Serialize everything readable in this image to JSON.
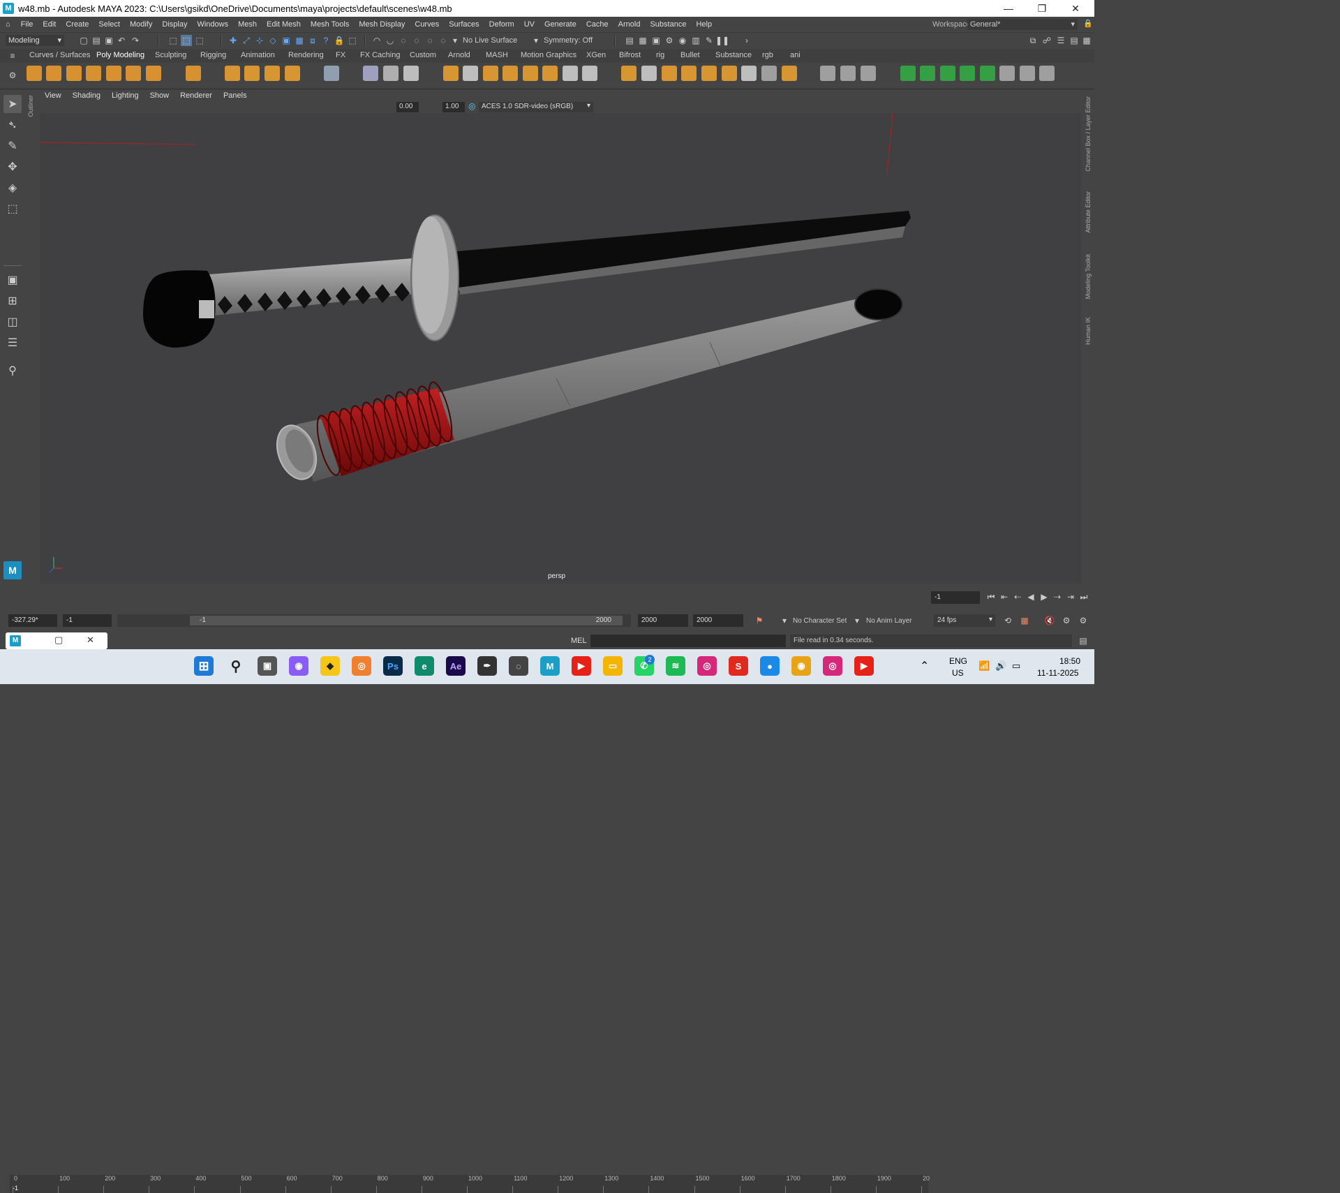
{
  "window": {
    "title": "w48.mb - Autodesk MAYA 2023: C:\\Users\\gsikd\\OneDrive\\Documents\\maya\\projects\\default\\scenes\\w48.mb",
    "app_icon": "M",
    "controls": {
      "minimize": "—",
      "restore": "❐",
      "close": "✕"
    }
  },
  "menubar": {
    "items": [
      "File",
      "Edit",
      "Create",
      "Select",
      "Modify",
      "Display",
      "Windows",
      "Mesh",
      "Edit Mesh",
      "Mesh Tools",
      "Mesh Display",
      "Curves",
      "Surfaces",
      "Deform",
      "UV",
      "Generate",
      "Cache",
      "Arnold",
      "Substance",
      "Help"
    ],
    "workspace_label": "Workspace:",
    "workspace_value": "General*"
  },
  "statusline": {
    "mode": "Modeling",
    "live_surface": "No Live Surface",
    "symmetry": "Symmetry: Off"
  },
  "shelf_tabs": [
    "Curves / Surfaces",
    "Poly Modeling",
    "Sculpting",
    "Rigging",
    "Animation",
    "Rendering",
    "FX",
    "FX Caching",
    "Custom",
    "Arnold",
    "MASH",
    "Motion Graphics",
    "XGen",
    "Bifrost",
    "rig",
    "Bullet",
    "Substance",
    "rgb",
    "ani"
  ],
  "panel_menu": [
    "View",
    "Shading",
    "Lighting",
    "Show",
    "Renderer",
    "Panels"
  ],
  "panel_toolbar": {
    "exposure": "0.00",
    "gamma": "1.00",
    "color_space": "ACES 1.0 SDR-video (sRGB)"
  },
  "side_tabs": {
    "left": "Outliner",
    "right": [
      "Channel Box / Layer Editor",
      "Attribute Editor",
      "Modeling Toolkit",
      "Human IK"
    ]
  },
  "viewport": {
    "camera_label": "persp"
  },
  "timeline": {
    "ticks": [
      "0",
      "100",
      "200",
      "300",
      "400",
      "500",
      "600",
      "700",
      "800",
      "900",
      "1000",
      "1100",
      "1200",
      "1300",
      "1400",
      "1500",
      "1600",
      "1700",
      "1800",
      "1900",
      "20"
    ],
    "current_frame": "-1",
    "current_frame_field": "-1"
  },
  "range": {
    "coord": "-327.29*",
    "start": "-1",
    "slider_start": "-1",
    "slider_end": "2000",
    "end": "2000",
    "end2": "2000",
    "character_set": "No Character Set",
    "anim_layer": "No Anim Layer",
    "fps": "24 fps"
  },
  "command": {
    "lang": "MEL",
    "result": "File read in  0.34 seconds."
  },
  "taskbar": {
    "lang_top": "ENG",
    "lang_bottom": "US",
    "time": "18:50",
    "date": "11-11-2025",
    "whatsapp_badge": "2",
    "icons": [
      "windows-start-icon",
      "search-icon",
      "task-view-icon",
      "copilot-icon",
      "sticky-icon",
      "blender-icon",
      "photoshop-icon",
      "edge-icon",
      "after-effects-icon",
      "inkscape-icon",
      "obs-icon",
      "maya-icon",
      "youtube-icon",
      "file-explorer-icon",
      "whatsapp-icon",
      "spotify-icon",
      "instagram-icon",
      "substance-icon",
      "app-blue-icon",
      "chrome-icon",
      "instagram2-icon",
      "youtube2-icon"
    ]
  }
}
